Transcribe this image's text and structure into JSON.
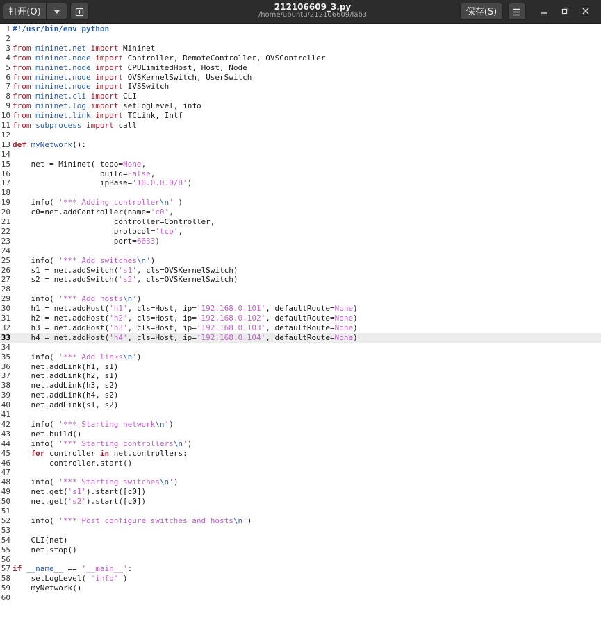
{
  "header": {
    "open_label": "打开(O)",
    "save_label": "保存(S)",
    "title": "212106609_3.py",
    "subtitle": "/home/ubuntu/212106609/lab3"
  },
  "icons": {
    "dropdown": "chevron-down-icon",
    "new_tab": "new-tab-icon",
    "menu": "hamburger-menu-icon",
    "minimize": "minimize-icon",
    "restore": "restore-icon",
    "close": "close-icon"
  },
  "colors": {
    "keyword": "#a51d2d",
    "module": "#2a5caa",
    "string": "#c061cb",
    "headerbar": "#2c2c2c",
    "current_line": "#ececec"
  },
  "editor": {
    "current_line": 33,
    "lines": [
      {
        "n": "1",
        "segs": [
          {
            "t": "#!/usr/bin/env python",
            "c": "sheb"
          }
        ]
      },
      {
        "n": "2",
        "segs": []
      },
      {
        "n": "3",
        "segs": [
          {
            "t": "from",
            "c": "imp"
          },
          {
            "t": " "
          },
          {
            "t": "mininet.net",
            "c": "mod"
          },
          {
            "t": " "
          },
          {
            "t": "import",
            "c": "imp"
          },
          {
            "t": " Mininet"
          }
        ]
      },
      {
        "n": "4",
        "segs": [
          {
            "t": "from",
            "c": "imp"
          },
          {
            "t": " "
          },
          {
            "t": "mininet.node",
            "c": "mod"
          },
          {
            "t": " "
          },
          {
            "t": "import",
            "c": "imp"
          },
          {
            "t": " Controller, RemoteController, OVSController"
          }
        ]
      },
      {
        "n": "5",
        "segs": [
          {
            "t": "from",
            "c": "imp"
          },
          {
            "t": " "
          },
          {
            "t": "mininet.node",
            "c": "mod"
          },
          {
            "t": " "
          },
          {
            "t": "import",
            "c": "imp"
          },
          {
            "t": " CPULimitedHost, Host, Node"
          }
        ]
      },
      {
        "n": "6",
        "segs": [
          {
            "t": "from",
            "c": "imp"
          },
          {
            "t": " "
          },
          {
            "t": "mininet.node",
            "c": "mod"
          },
          {
            "t": " "
          },
          {
            "t": "import",
            "c": "imp"
          },
          {
            "t": " OVSKernelSwitch, UserSwitch"
          }
        ]
      },
      {
        "n": "7",
        "segs": [
          {
            "t": "from",
            "c": "imp"
          },
          {
            "t": " "
          },
          {
            "t": "mininet.node",
            "c": "mod"
          },
          {
            "t": " "
          },
          {
            "t": "import",
            "c": "imp"
          },
          {
            "t": " IVSSwitch"
          }
        ]
      },
      {
        "n": "8",
        "segs": [
          {
            "t": "from",
            "c": "imp"
          },
          {
            "t": " "
          },
          {
            "t": "mininet.cli",
            "c": "mod"
          },
          {
            "t": " "
          },
          {
            "t": "import",
            "c": "imp"
          },
          {
            "t": " CLI"
          }
        ]
      },
      {
        "n": "9",
        "segs": [
          {
            "t": "from",
            "c": "imp"
          },
          {
            "t": " "
          },
          {
            "t": "mininet.log",
            "c": "mod"
          },
          {
            "t": " "
          },
          {
            "t": "import",
            "c": "imp"
          },
          {
            "t": " setLogLevel, info"
          }
        ]
      },
      {
        "n": "10",
        "segs": [
          {
            "t": "from",
            "c": "imp"
          },
          {
            "t": " "
          },
          {
            "t": "mininet.link",
            "c": "mod"
          },
          {
            "t": " "
          },
          {
            "t": "import",
            "c": "imp"
          },
          {
            "t": " TCLink, Intf"
          }
        ]
      },
      {
        "n": "11",
        "segs": [
          {
            "t": "from",
            "c": "imp"
          },
          {
            "t": " "
          },
          {
            "t": "subprocess",
            "c": "mod"
          },
          {
            "t": " "
          },
          {
            "t": "import",
            "c": "imp"
          },
          {
            "t": " call"
          }
        ]
      },
      {
        "n": "12",
        "segs": []
      },
      {
        "n": "13",
        "segs": [
          {
            "t": "def",
            "c": "kw"
          },
          {
            "t": " "
          },
          {
            "t": "myNetwork",
            "c": "fn"
          },
          {
            "t": "():"
          }
        ]
      },
      {
        "n": "14",
        "segs": []
      },
      {
        "n": "15",
        "segs": [
          {
            "t": "    net = Mininet( topo="
          },
          {
            "t": "None",
            "c": "const"
          },
          {
            "t": ","
          }
        ]
      },
      {
        "n": "16",
        "segs": [
          {
            "t": "                   build="
          },
          {
            "t": "False",
            "c": "const"
          },
          {
            "t": ","
          }
        ]
      },
      {
        "n": "17",
        "segs": [
          {
            "t": "                   ipBase="
          },
          {
            "t": "'10.0.0.0/8'",
            "c": "str"
          },
          {
            "t": ")"
          }
        ]
      },
      {
        "n": "18",
        "segs": []
      },
      {
        "n": "19",
        "segs": [
          {
            "t": "    info( "
          },
          {
            "t": "'*** Adding controller",
            "c": "str"
          },
          {
            "t": "\\n",
            "c": "esc"
          },
          {
            "t": "'",
            "c": "str"
          },
          {
            "t": " )"
          }
        ]
      },
      {
        "n": "20",
        "segs": [
          {
            "t": "    c0=net.addController(name="
          },
          {
            "t": "'c0'",
            "c": "str"
          },
          {
            "t": ","
          }
        ]
      },
      {
        "n": "21",
        "segs": [
          {
            "t": "                      controller=Controller,"
          }
        ]
      },
      {
        "n": "22",
        "segs": [
          {
            "t": "                      protocol="
          },
          {
            "t": "'tcp'",
            "c": "str"
          },
          {
            "t": ","
          }
        ]
      },
      {
        "n": "23",
        "segs": [
          {
            "t": "                      port="
          },
          {
            "t": "6633",
            "c": "const"
          },
          {
            "t": ")"
          }
        ]
      },
      {
        "n": "24",
        "segs": []
      },
      {
        "n": "25",
        "segs": [
          {
            "t": "    info( "
          },
          {
            "t": "'*** Add switches",
            "c": "str"
          },
          {
            "t": "\\n",
            "c": "esc"
          },
          {
            "t": "'",
            "c": "str"
          },
          {
            "t": ")"
          }
        ]
      },
      {
        "n": "26",
        "segs": [
          {
            "t": "    s1 = net.addSwitch("
          },
          {
            "t": "'s1'",
            "c": "str"
          },
          {
            "t": ", cls=OVSKernelSwitch)"
          }
        ]
      },
      {
        "n": "27",
        "segs": [
          {
            "t": "    s2 = net.addSwitch("
          },
          {
            "t": "'s2'",
            "c": "str"
          },
          {
            "t": ", cls=OVSKernelSwitch)"
          }
        ]
      },
      {
        "n": "28",
        "segs": []
      },
      {
        "n": "29",
        "segs": [
          {
            "t": "    info( "
          },
          {
            "t": "'*** Add hosts",
            "c": "str"
          },
          {
            "t": "\\n",
            "c": "esc"
          },
          {
            "t": "'",
            "c": "str"
          },
          {
            "t": ")"
          }
        ]
      },
      {
        "n": "30",
        "segs": [
          {
            "t": "    h1 = net.addHost("
          },
          {
            "t": "'h1'",
            "c": "str"
          },
          {
            "t": ", cls=Host, ip="
          },
          {
            "t": "'192.168.0.101'",
            "c": "str"
          },
          {
            "t": ", defaultRoute="
          },
          {
            "t": "None",
            "c": "const"
          },
          {
            "t": ")"
          }
        ]
      },
      {
        "n": "31",
        "segs": [
          {
            "t": "    h2 = net.addHost("
          },
          {
            "t": "'h2'",
            "c": "str"
          },
          {
            "t": ", cls=Host, ip="
          },
          {
            "t": "'192.168.0.102'",
            "c": "str"
          },
          {
            "t": ", defaultRoute="
          },
          {
            "t": "None",
            "c": "const"
          },
          {
            "t": ")"
          }
        ]
      },
      {
        "n": "32",
        "segs": [
          {
            "t": "    h3 = net.addHost("
          },
          {
            "t": "'h3'",
            "c": "str"
          },
          {
            "t": ", cls=Host, ip="
          },
          {
            "t": "'192.168.0.103'",
            "c": "str"
          },
          {
            "t": ", defaultRoute="
          },
          {
            "t": "None",
            "c": "const"
          },
          {
            "t": ")"
          }
        ]
      },
      {
        "n": "33",
        "segs": [
          {
            "t": "    h4 = net.addHost("
          },
          {
            "t": "'h4'",
            "c": "str"
          },
          {
            "t": ", cls=Host, ip="
          },
          {
            "t": "'192.168.0.104'",
            "c": "str"
          },
          {
            "t": ", defaultRoute="
          },
          {
            "t": "None",
            "c": "const"
          },
          {
            "t": ")"
          }
        ]
      },
      {
        "n": "34",
        "segs": []
      },
      {
        "n": "35",
        "segs": [
          {
            "t": "    info( "
          },
          {
            "t": "'*** Add links",
            "c": "str"
          },
          {
            "t": "\\n",
            "c": "esc"
          },
          {
            "t": "'",
            "c": "str"
          },
          {
            "t": ")"
          }
        ]
      },
      {
        "n": "36",
        "segs": [
          {
            "t": "    net.addLink(h1, s1)"
          }
        ]
      },
      {
        "n": "37",
        "segs": [
          {
            "t": "    net.addLink(h2, s1)"
          }
        ]
      },
      {
        "n": "38",
        "segs": [
          {
            "t": "    net.addLink(h3, s2)"
          }
        ]
      },
      {
        "n": "39",
        "segs": [
          {
            "t": "    net.addLink(h4, s2)"
          }
        ]
      },
      {
        "n": "40",
        "segs": [
          {
            "t": "    net.addLink(s1, s2)"
          }
        ]
      },
      {
        "n": "41",
        "segs": []
      },
      {
        "n": "42",
        "segs": [
          {
            "t": "    info( "
          },
          {
            "t": "'*** Starting network",
            "c": "str"
          },
          {
            "t": "\\n",
            "c": "esc"
          },
          {
            "t": "'",
            "c": "str"
          },
          {
            "t": ")"
          }
        ]
      },
      {
        "n": "43",
        "segs": [
          {
            "t": "    net.build()"
          }
        ]
      },
      {
        "n": "44",
        "segs": [
          {
            "t": "    info( "
          },
          {
            "t": "'*** Starting controllers",
            "c": "str"
          },
          {
            "t": "\\n",
            "c": "esc"
          },
          {
            "t": "'",
            "c": "str"
          },
          {
            "t": ")"
          }
        ]
      },
      {
        "n": "45",
        "segs": [
          {
            "t": "    "
          },
          {
            "t": "for",
            "c": "kw"
          },
          {
            "t": " controller "
          },
          {
            "t": "in",
            "c": "kw"
          },
          {
            "t": " net.controllers:"
          }
        ]
      },
      {
        "n": "46",
        "segs": [
          {
            "t": "        controller.start()"
          }
        ]
      },
      {
        "n": "47",
        "segs": []
      },
      {
        "n": "48",
        "segs": [
          {
            "t": "    info( "
          },
          {
            "t": "'*** Starting switches",
            "c": "str"
          },
          {
            "t": "\\n",
            "c": "esc"
          },
          {
            "t": "'",
            "c": "str"
          },
          {
            "t": ")"
          }
        ]
      },
      {
        "n": "49",
        "segs": [
          {
            "t": "    net.get("
          },
          {
            "t": "'s1'",
            "c": "str"
          },
          {
            "t": ").start([c0])"
          }
        ]
      },
      {
        "n": "50",
        "segs": [
          {
            "t": "    net.get("
          },
          {
            "t": "'s2'",
            "c": "str"
          },
          {
            "t": ").start([c0])"
          }
        ]
      },
      {
        "n": "51",
        "segs": []
      },
      {
        "n": "52",
        "segs": [
          {
            "t": "    info( "
          },
          {
            "t": "'*** Post configure switches and hosts",
            "c": "str"
          },
          {
            "t": "\\n",
            "c": "esc"
          },
          {
            "t": "'",
            "c": "str"
          },
          {
            "t": ")"
          }
        ]
      },
      {
        "n": "53",
        "segs": []
      },
      {
        "n": "54",
        "segs": [
          {
            "t": "    CLI(net)"
          }
        ]
      },
      {
        "n": "55",
        "segs": [
          {
            "t": "    net.stop()"
          }
        ]
      },
      {
        "n": "56",
        "segs": []
      },
      {
        "n": "57",
        "segs": [
          {
            "t": "if",
            "c": "kw"
          },
          {
            "t": " "
          },
          {
            "t": "__name__",
            "c": "dunder"
          },
          {
            "t": " == "
          },
          {
            "t": "'__main__'",
            "c": "str"
          },
          {
            "t": ":"
          }
        ]
      },
      {
        "n": "58",
        "segs": [
          {
            "t": "    setLogLevel( "
          },
          {
            "t": "'info'",
            "c": "str"
          },
          {
            "t": " )"
          }
        ]
      },
      {
        "n": "59",
        "segs": [
          {
            "t": "    myNetwork()"
          }
        ]
      },
      {
        "n": "60",
        "segs": []
      }
    ]
  }
}
